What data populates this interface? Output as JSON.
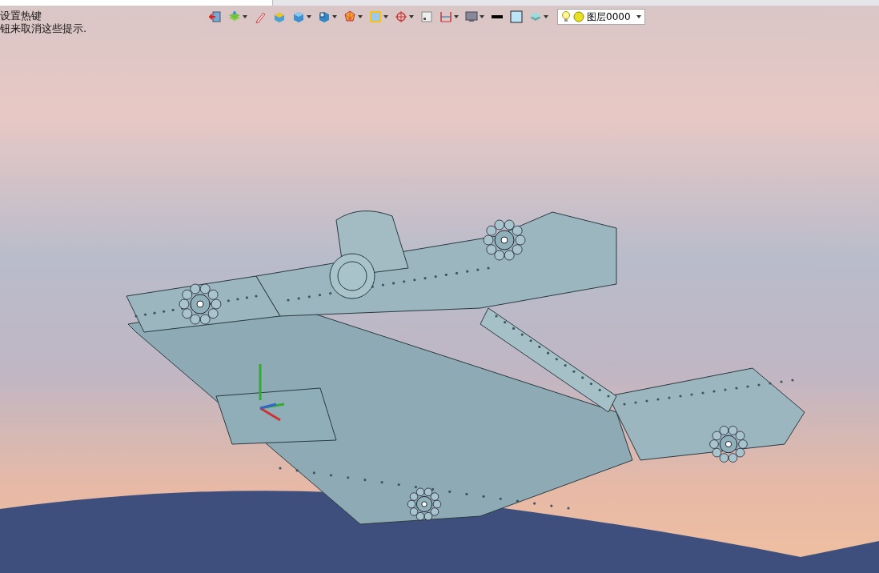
{
  "hint": {
    "lines": [
      "设置热键",
      "钮来取消这些提示."
    ]
  },
  "toolbar": {
    "items": [
      {
        "kind": "exit",
        "dropdown": false
      },
      {
        "kind": "layers",
        "dropdown": true
      },
      {
        "kind": "pencil",
        "dropdown": false
      },
      {
        "kind": "box",
        "dropdown": false
      },
      {
        "kind": "cube",
        "dropdown": true
      },
      {
        "kind": "view",
        "dropdown": true
      },
      {
        "kind": "polygon",
        "dropdown": true
      },
      {
        "kind": "frame",
        "dropdown": true
      },
      {
        "kind": "target",
        "dropdown": true
      },
      {
        "kind": "square",
        "dropdown": false
      },
      {
        "kind": "dimension",
        "dropdown": true
      },
      {
        "kind": "monitor",
        "dropdown": true
      },
      {
        "kind": "linecolor",
        "dropdown": false
      },
      {
        "kind": "fillcolor",
        "dropdown": false
      },
      {
        "kind": "stack",
        "dropdown": true
      }
    ]
  },
  "layer": {
    "value": "图层0000"
  }
}
